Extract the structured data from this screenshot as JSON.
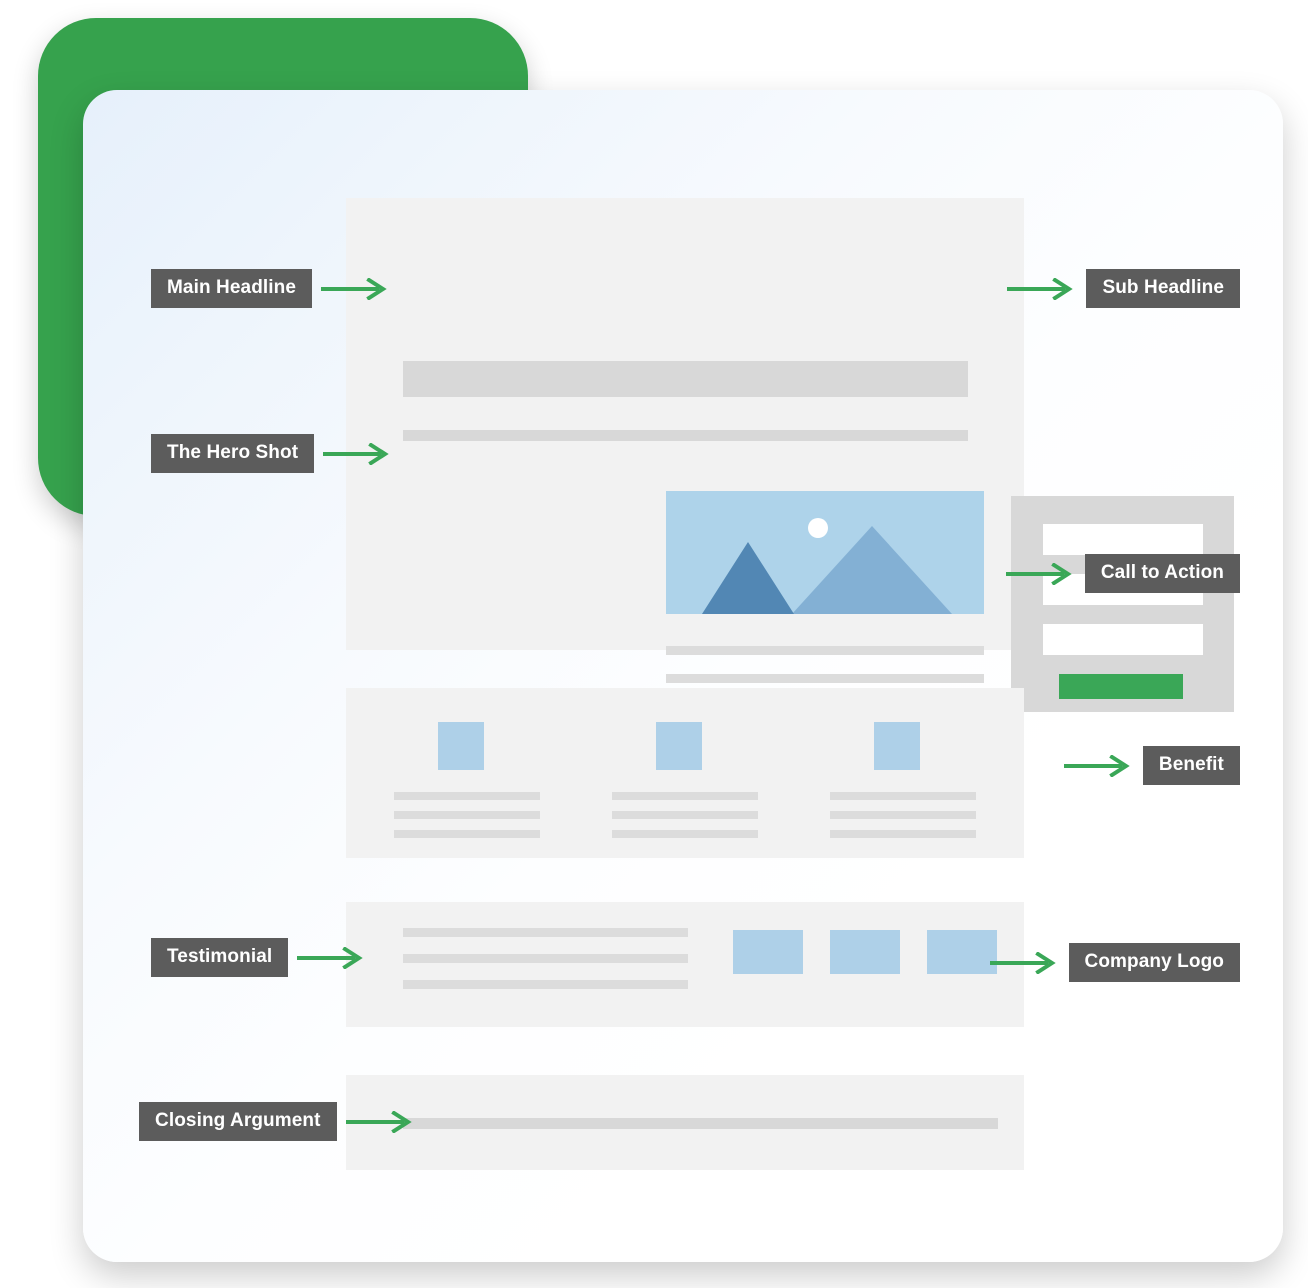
{
  "theme": {
    "accent_green": "#36a24d",
    "cta_green": "#3aa757",
    "arrow_green": "#3aa757",
    "label_gray": "#5c5c5c",
    "panel_gray": "#f2f2f2",
    "bar_gray": "#d8d8d8",
    "line_gray": "#dcdcdc",
    "form_gray": "#d8d8d8",
    "sky_blue": "#aed3ea",
    "mountain_back": "#83b0d4",
    "mountain_front": "#5287b4",
    "icon_blue": "#aed0e8",
    "card_tint": "#e6f0fb"
  },
  "callouts": {
    "left": [
      {
        "id": "main-headline",
        "label": "Main Headline",
        "arrow": "arrow-right-icon"
      },
      {
        "id": "hero-shot",
        "label": "The Hero Shot",
        "arrow": "arrow-right-icon"
      },
      {
        "id": "testimonial",
        "label": "Testimonial",
        "arrow": "arrow-right-icon"
      },
      {
        "id": "closing-argument",
        "label": "Closing Argument",
        "arrow": "arrow-right-icon"
      }
    ],
    "right": [
      {
        "id": "sub-headline",
        "label": "Sub Headline",
        "arrow": "arrow-right-icon"
      },
      {
        "id": "call-to-action",
        "label": "Call to Action",
        "arrow": "arrow-right-icon"
      },
      {
        "id": "benefit",
        "label": "Benefit",
        "arrow": "arrow-right-icon"
      },
      {
        "id": "company-logo",
        "label": "Company Logo",
        "arrow": "arrow-right-icon"
      }
    ]
  },
  "wireframe": {
    "sections": [
      {
        "id": "hero",
        "name": "hero-section"
      },
      {
        "id": "benefits",
        "name": "benefits-section"
      },
      {
        "id": "testimonial",
        "name": "testimonial-section"
      },
      {
        "id": "closing",
        "name": "closing-section"
      }
    ],
    "hero": {
      "headline_bar": "placeholder-headline-bar",
      "subheadline_bar": "placeholder-subheadline-bar",
      "image": {
        "name": "mountain-landscape-placeholder",
        "elements": [
          "sun-circle",
          "mountain-back",
          "mountain-front"
        ]
      },
      "body_lines": 3,
      "form": {
        "inputs": 3,
        "cta": "cta-button-placeholder"
      }
    },
    "benefits": {
      "columns": [
        {
          "icon": "benefit-icon-placeholder",
          "lines": 3
        },
        {
          "icon": "benefit-icon-placeholder",
          "lines": 3
        },
        {
          "icon": "benefit-icon-placeholder",
          "lines": 3
        }
      ]
    },
    "testimonial": {
      "quote_lines": 3,
      "logos": [
        "company-logo-placeholder",
        "company-logo-placeholder",
        "company-logo-placeholder"
      ]
    },
    "closing": {
      "line": "closing-argument-bar"
    }
  }
}
